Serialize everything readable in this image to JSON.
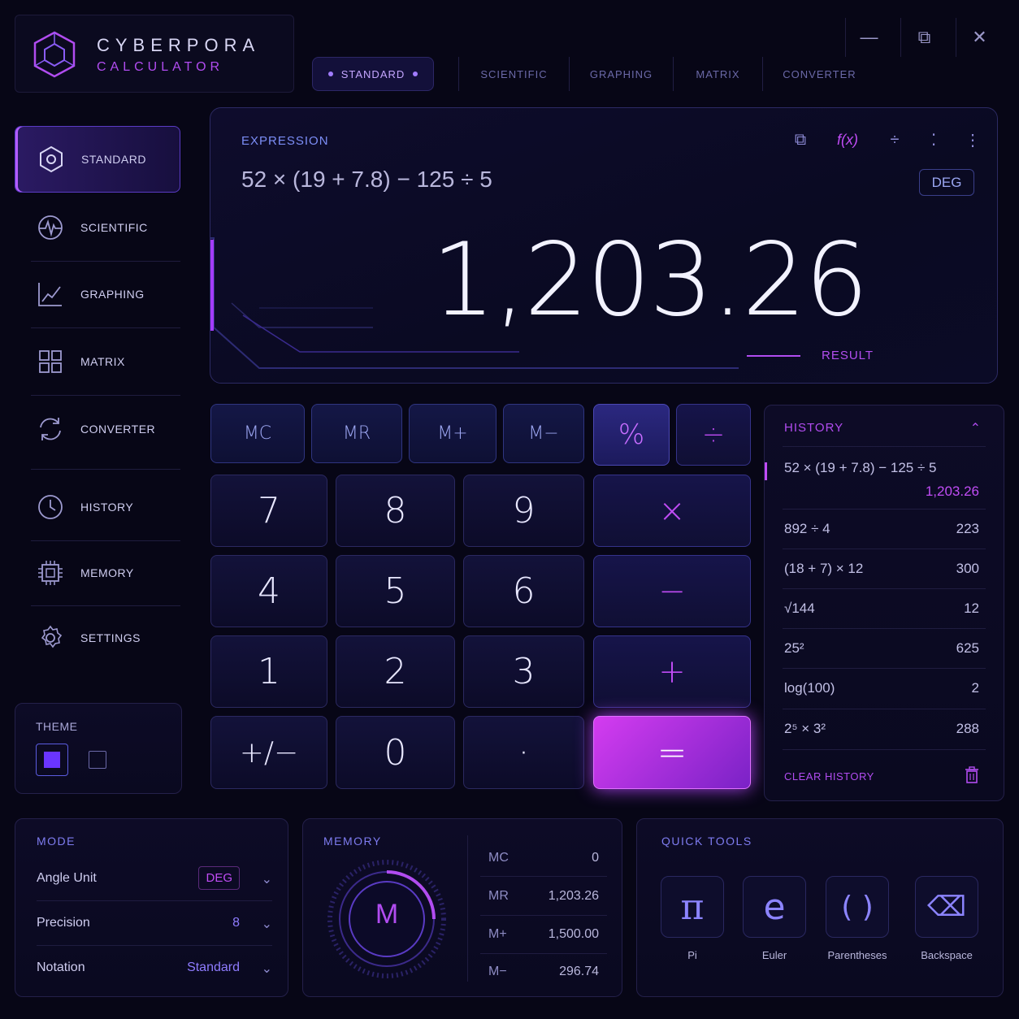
{
  "app": {
    "title_line1": "CYBERPORA",
    "title_line2": "CALCULATOR"
  },
  "window_controls": {
    "minimize": "—",
    "maximize": "⧉",
    "close": "✕"
  },
  "top_tabs": [
    "STANDARD",
    "SCIENTIFIC",
    "GRAPHING",
    "MATRIX",
    "CONVERTER"
  ],
  "sidebar": {
    "items": [
      {
        "label": "STANDARD",
        "icon": "hexagon-icon"
      },
      {
        "label": "SCIENTIFIC",
        "icon": "waveform-icon"
      },
      {
        "label": "GRAPHING",
        "icon": "chart-icon"
      },
      {
        "label": "MATRIX",
        "icon": "grid-icon"
      },
      {
        "label": "CONVERTER",
        "icon": "refresh-icon"
      },
      {
        "label": "HISTORY",
        "icon": "clock-icon"
      },
      {
        "label": "MEMORY",
        "icon": "chip-icon"
      },
      {
        "label": "SETTINGS",
        "icon": "gear-icon"
      }
    ],
    "theme_label": "THEME"
  },
  "display": {
    "expression_label": "EXPRESSION",
    "expression": "52 × (19 + 7.8) − 125 ÷ 5",
    "result": "1,203.26",
    "result_label": "RESULT",
    "angle": "DEG",
    "tools": [
      "⧉",
      "f(x)",
      "÷",
      "⁚",
      "⋮"
    ]
  },
  "keypad": {
    "memory_row": [
      "MC",
      "MR",
      "M+",
      "M−",
      "%",
      "÷"
    ],
    "rows": [
      [
        "7",
        "8",
        "9",
        "×"
      ],
      [
        "4",
        "5",
        "6",
        "−"
      ],
      [
        "1",
        "2",
        "3",
        "+"
      ],
      [
        "+/−",
        "0",
        "·",
        "="
      ]
    ]
  },
  "history": {
    "title": "HISTORY",
    "collapse": "⌃",
    "latest": {
      "expr": "52 × (19 + 7.8) − 125 ÷ 5",
      "value": "1,203.26"
    },
    "entries": [
      {
        "expr": "892 ÷ 4",
        "value": "223"
      },
      {
        "expr": "(18 + 7) × 12",
        "value": "300"
      },
      {
        "expr": "√144",
        "value": "12"
      },
      {
        "expr": "25²",
        "value": "625"
      },
      {
        "expr": "log(100)",
        "value": "2"
      },
      {
        "expr": "2⁵ × 3²",
        "value": "288"
      }
    ],
    "clear": "CLEAR HISTORY"
  },
  "mode": {
    "title": "MODE",
    "rows": [
      {
        "label": "Angle Unit",
        "value": "DEG"
      },
      {
        "label": "Precision",
        "value": "8"
      },
      {
        "label": "Notation",
        "value": "Standard"
      }
    ]
  },
  "memory": {
    "title": "MEMORY",
    "badge": "M",
    "rows": [
      {
        "label": "MC",
        "value": "0"
      },
      {
        "label": "MR",
        "value": "1,203.26"
      },
      {
        "label": "M+",
        "value": "1,500.00"
      },
      {
        "label": "M−",
        "value": "296.74"
      }
    ]
  },
  "quick_tools": {
    "title": "QUICK TOOLS",
    "items": [
      {
        "symbol": "π",
        "label": "Pi"
      },
      {
        "symbol": "e",
        "label": "Euler"
      },
      {
        "symbol": "( )",
        "label": "Parentheses"
      },
      {
        "symbol": "⌫",
        "label": "Backspace"
      }
    ]
  },
  "colors": {
    "accent": "#b14cf0",
    "primary": "#7e7cf0",
    "background": "#070616"
  }
}
